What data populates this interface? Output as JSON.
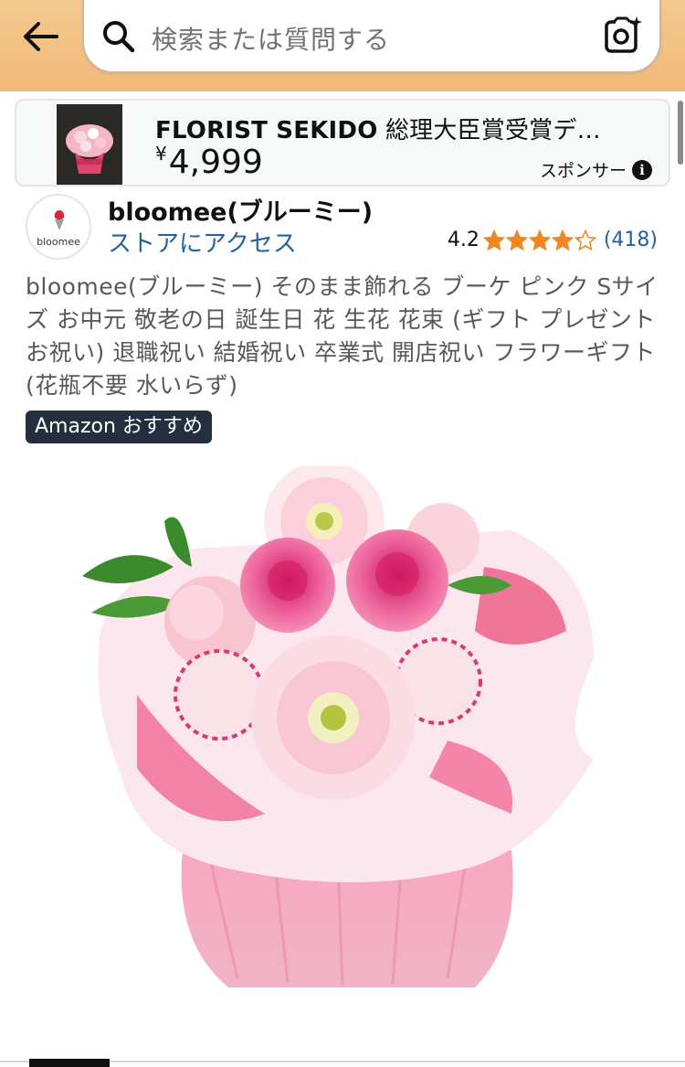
{
  "header": {
    "search_placeholder": "検索または質問する"
  },
  "sponsored": {
    "title_brand": "FLORIST SEKIDO",
    "title_rest": " 総理大臣賞受賞デ…",
    "currency": "¥",
    "price": "4,999",
    "label": "スポンサー",
    "info_glyph": "i"
  },
  "store": {
    "logo_text": "bloomee",
    "name": "bloomee(ブルーミー)",
    "link": "ストアにアクセス",
    "rating": "4.2",
    "rating_stars": 4.2,
    "rating_count": "(418)"
  },
  "product": {
    "title": "bloomee(ブルーミー) そのまま飾れる ブーケ ピンク Sサイズ お中元 敬老の日 誕生日 花 生花 花束 (ギフト プレゼント お祝い) 退職祝い 結婚祝い 卒業式 開店祝い フラワーギフト (花瓶不要 水いらず)",
    "badge": "Amazon おすすめ"
  },
  "colors": {
    "header_bg": "#f0b979",
    "link": "#2162a1",
    "star": "#f3871f",
    "badge_bg": "#232f3e"
  },
  "icons": [
    "back-arrow-icon",
    "search-icon",
    "camera-lens-icon",
    "info-icon",
    "star-icon"
  ]
}
